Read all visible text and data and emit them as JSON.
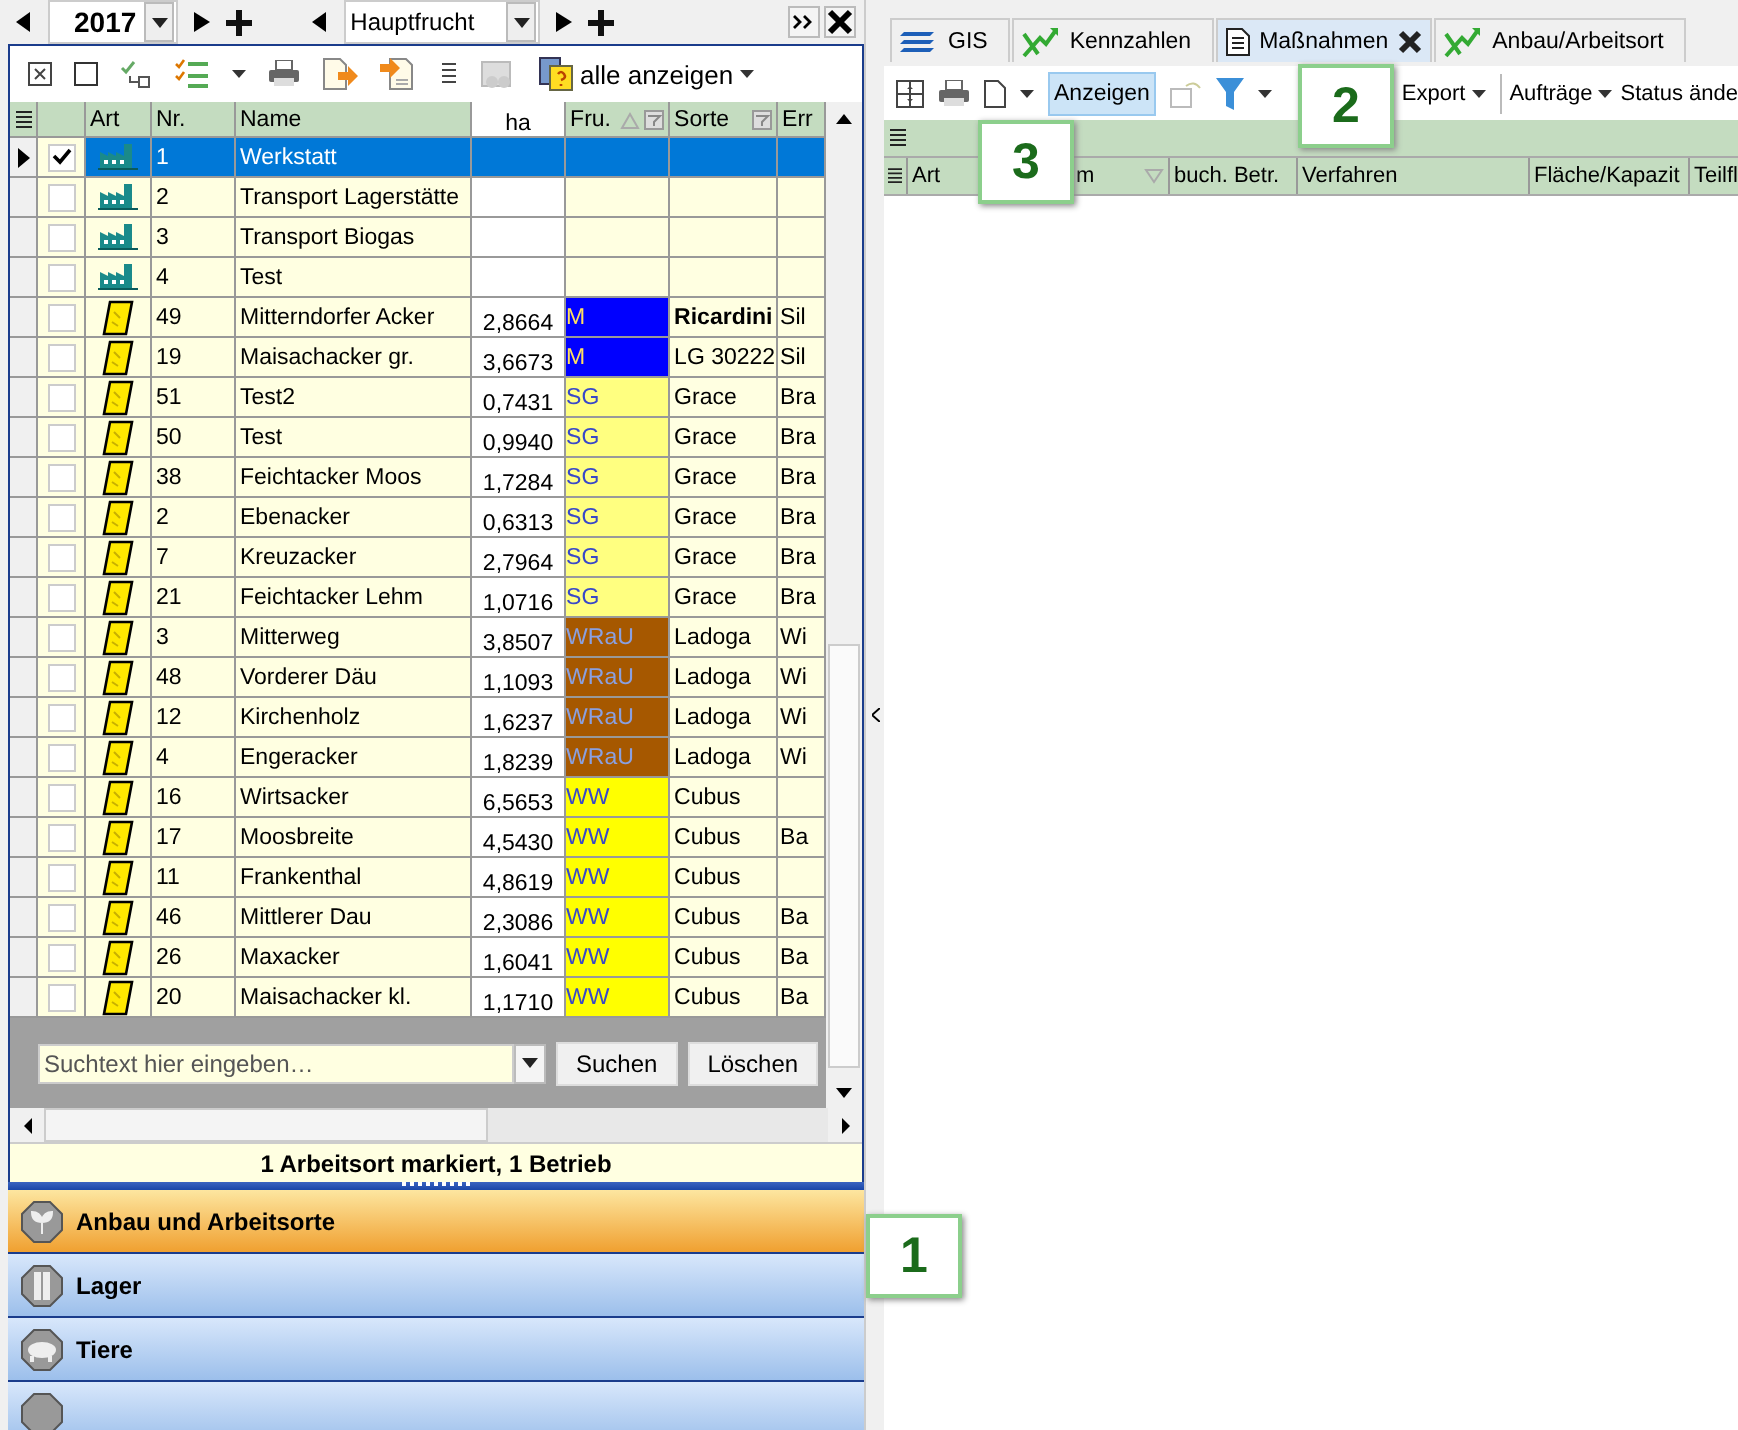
{
  "left_toolbar": {
    "year": "2017",
    "crop_type": "Hauptfrucht"
  },
  "list_toolbar": {
    "show_all": "alle anzeigen"
  },
  "table": {
    "columns": [
      "Art",
      "Nr.",
      "Name",
      "ha",
      "Fru.",
      "Sorte",
      "Err"
    ],
    "rows": [
      {
        "kind": "building",
        "selected": true,
        "checked": true,
        "nr": "1",
        "name": "Werkstatt"
      },
      {
        "kind": "building",
        "selected": false,
        "checked": false,
        "nr": "2",
        "name": "Transport Lagerstätte"
      },
      {
        "kind": "building",
        "selected": false,
        "checked": false,
        "nr": "3",
        "name": "Transport Biogas"
      },
      {
        "kind": "building",
        "selected": false,
        "checked": false,
        "nr": "4",
        "name": "Test"
      },
      {
        "kind": "field",
        "selected": false,
        "checked": false,
        "nr": "49",
        "name": "Mitterndorfer Acker",
        "ha": "2,8664",
        "crop": "M",
        "color": "#0000ff",
        "variety": "Ricardini",
        "variety_bold": true,
        "column_7": "Sil"
      },
      {
        "kind": "field",
        "selected": false,
        "checked": false,
        "nr": "19",
        "name": "Maisachacker gr.",
        "ha": "3,6673",
        "crop": "M",
        "color": "#0000ff",
        "variety": "LG 30222",
        "variety_bold": false,
        "column_7": "Sil"
      },
      {
        "kind": "field",
        "selected": false,
        "checked": false,
        "nr": "51",
        "name": "Test2",
        "ha": "0,7431",
        "crop": "SG",
        "color": "#ffff80",
        "variety": "Grace",
        "variety_bold": false,
        "column_7": "Bra"
      },
      {
        "kind": "field",
        "selected": false,
        "checked": false,
        "nr": "50",
        "name": "Test",
        "ha": "0,9940",
        "crop": "SG",
        "color": "#ffff80",
        "variety": "Grace",
        "variety_bold": false,
        "column_7": "Bra"
      },
      {
        "kind": "field",
        "selected": false,
        "checked": false,
        "nr": "38",
        "name": "Feichtacker Moos",
        "ha": "1,7284",
        "crop": "SG",
        "color": "#ffff80",
        "variety": "Grace",
        "variety_bold": false,
        "column_7": "Bra"
      },
      {
        "kind": "field",
        "selected": false,
        "checked": false,
        "nr": "2",
        "name": "Ebenacker",
        "ha": "0,6313",
        "crop": "SG",
        "color": "#ffff80",
        "variety": "Grace",
        "variety_bold": false,
        "column_7": "Bra"
      },
      {
        "kind": "field",
        "selected": false,
        "checked": false,
        "nr": "7",
        "name": "Kreuzacker",
        "ha": "2,7964",
        "crop": "SG",
        "color": "#ffff80",
        "variety": "Grace",
        "variety_bold": false,
        "column_7": "Bra"
      },
      {
        "kind": "field",
        "selected": false,
        "checked": false,
        "nr": "21",
        "name": "Feichtacker Lehm",
        "ha": "1,0716",
        "crop": "SG",
        "color": "#ffff80",
        "variety": "Grace",
        "variety_bold": false,
        "column_7": "Bra"
      },
      {
        "kind": "field",
        "selected": false,
        "checked": false,
        "nr": "3",
        "name": "Mitterweg",
        "ha": "3,8507",
        "crop": "WRaU",
        "color": "#a65800",
        "variety": "Ladoga",
        "variety_bold": false,
        "column_7": "Wi"
      },
      {
        "kind": "field",
        "selected": false,
        "checked": false,
        "nr": "48",
        "name": "Vorderer Däu",
        "ha": "1,1093",
        "crop": "WRaU",
        "color": "#a65800",
        "variety": "Ladoga",
        "variety_bold": false,
        "column_7": "Wi"
      },
      {
        "kind": "field",
        "selected": false,
        "checked": false,
        "nr": "12",
        "name": "Kirchenholz",
        "ha": "1,6237",
        "crop": "WRaU",
        "color": "#a65800",
        "variety": "Ladoga",
        "variety_bold": false,
        "column_7": "Wi"
      },
      {
        "kind": "field",
        "selected": false,
        "checked": false,
        "nr": "4",
        "name": "Engeracker",
        "ha": "1,8239",
        "crop": "WRaU",
        "color": "#a65800",
        "variety": "Ladoga",
        "variety_bold": false,
        "column_7": "Wi"
      },
      {
        "kind": "field",
        "selected": false,
        "checked": false,
        "nr": "16",
        "name": "Wirtsacker",
        "ha": "6,5653",
        "crop": "WW",
        "color": "#ffff00",
        "variety": "Cubus",
        "variety_bold": false
      },
      {
        "kind": "field",
        "selected": false,
        "checked": false,
        "nr": "17",
        "name": "Moosbreite",
        "ha": "4,5430",
        "crop": "WW",
        "color": "#ffff00",
        "variety": "Cubus",
        "variety_bold": false,
        "column_7": "Ba"
      },
      {
        "kind": "field",
        "selected": false,
        "checked": false,
        "nr": "11",
        "name": "Frankenthal",
        "ha": "4,8619",
        "crop": "WW",
        "color": "#ffff00",
        "variety": "Cubus",
        "variety_bold": false
      },
      {
        "kind": "field",
        "selected": false,
        "checked": false,
        "nr": "46",
        "name": "Mittlerer  Dau",
        "ha": "2,3086",
        "crop": "WW",
        "color": "#ffff00",
        "variety": "Cubus",
        "variety_bold": false,
        "column_7": "Ba"
      },
      {
        "kind": "field",
        "selected": false,
        "checked": false,
        "nr": "26",
        "name": "Maxacker",
        "ha": "1,6041",
        "crop": "WW",
        "color": "#ffff00",
        "variety": "Cubus",
        "variety_bold": false,
        "column_7": "Ba"
      },
      {
        "kind": "field",
        "selected": false,
        "checked": false,
        "nr": "20",
        "name": "Maisachacker kl.",
        "ha": "1,1710",
        "crop": "WW",
        "color": "#ffff00",
        "variety": "Cubus",
        "variety_bold": false,
        "column_7": "Ba"
      }
    ]
  },
  "search": {
    "placeholder": "Suchtext hier eingeben…",
    "buttons": [
      "Suchen",
      "Löschen"
    ]
  },
  "status": "1 Arbeitsort markiert, 1 Betrieb",
  "nav": [
    {
      "label": "Anbau und Arbeitsorte",
      "kind": "plant",
      "selected": true
    },
    {
      "label": "Lager",
      "kind": "silo",
      "selected": false
    },
    {
      "label": "Tiere",
      "kind": "pig",
      "selected": false
    },
    {
      "kind": "blank",
      "selected": false
    }
  ],
  "tabs": [
    {
      "label": "GIS",
      "kind": "layers",
      "selected": false,
      "closable": false
    },
    {
      "label": "Kennzahlen",
      "kind": "chart",
      "selected": false,
      "closable": false
    },
    {
      "label": "Maßnahmen",
      "kind": "doc",
      "selected": true,
      "closable": true
    },
    {
      "label": "Anbau/Arbeitsort",
      "kind": "chart",
      "selected": false,
      "closable": false
    }
  ],
  "right_toolbar": {
    "show": "Anzeigen",
    "menus": [
      "Export",
      "Aufträge"
    ],
    "status_menu": "Status ände"
  },
  "right_table": {
    "columns": [
      "Art",
      "m",
      "buch. Betr.",
      "Verfahren",
      "Fläche/Kapazit",
      "Teilfl"
    ]
  },
  "callouts": [
    "1",
    "2",
    "3"
  ]
}
